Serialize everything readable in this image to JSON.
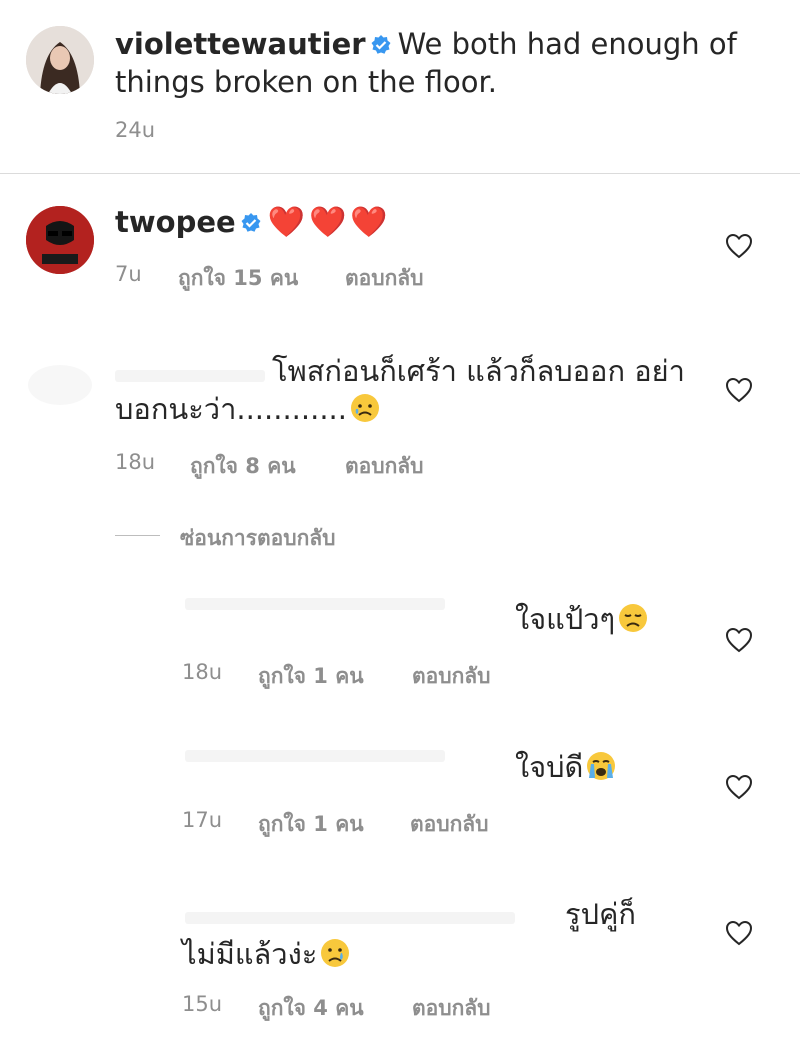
{
  "post": {
    "username": "violettewautier",
    "caption": "We both had enough of things broken on the floor.",
    "time": "24u"
  },
  "comments": [
    {
      "username": "twopee",
      "text": "❤️❤️❤️",
      "time": "7u",
      "likes": "ถูกใจ 15 คน",
      "reply": "ตอบกลับ"
    },
    {
      "text_line1": "โพสก่อนก็เศร้า แล้วก็ลบออก อย่า",
      "text_line2": "บอกนะว่า............",
      "time": "18u",
      "likes": "ถูกใจ 8 คน",
      "reply": "ตอบกลับ"
    }
  ],
  "hide_replies": "ซ่อนการตอบกลับ",
  "replies": [
    {
      "text": "ใจแป้วๆ",
      "emoji": "disappointed-face",
      "time": "18u",
      "likes": "ถูกใจ 1 คน",
      "reply": "ตอบกลับ"
    },
    {
      "text": "ใจบ่ดี",
      "emoji": "crying-face",
      "time": "17u",
      "likes": "ถูกใจ 1 คน",
      "reply": "ตอบกลับ"
    },
    {
      "text_line1": "รูปคู่ก็",
      "text_line2": "ไม่มีแล้วง่ะ",
      "emoji": "sad-tear-face",
      "time": "15u",
      "likes": "ถูกใจ 4 คน",
      "reply": "ตอบกลับ"
    }
  ],
  "colors": {
    "verified": "#3897f0",
    "muted": "#8e8e8e",
    "text": "#262626"
  }
}
